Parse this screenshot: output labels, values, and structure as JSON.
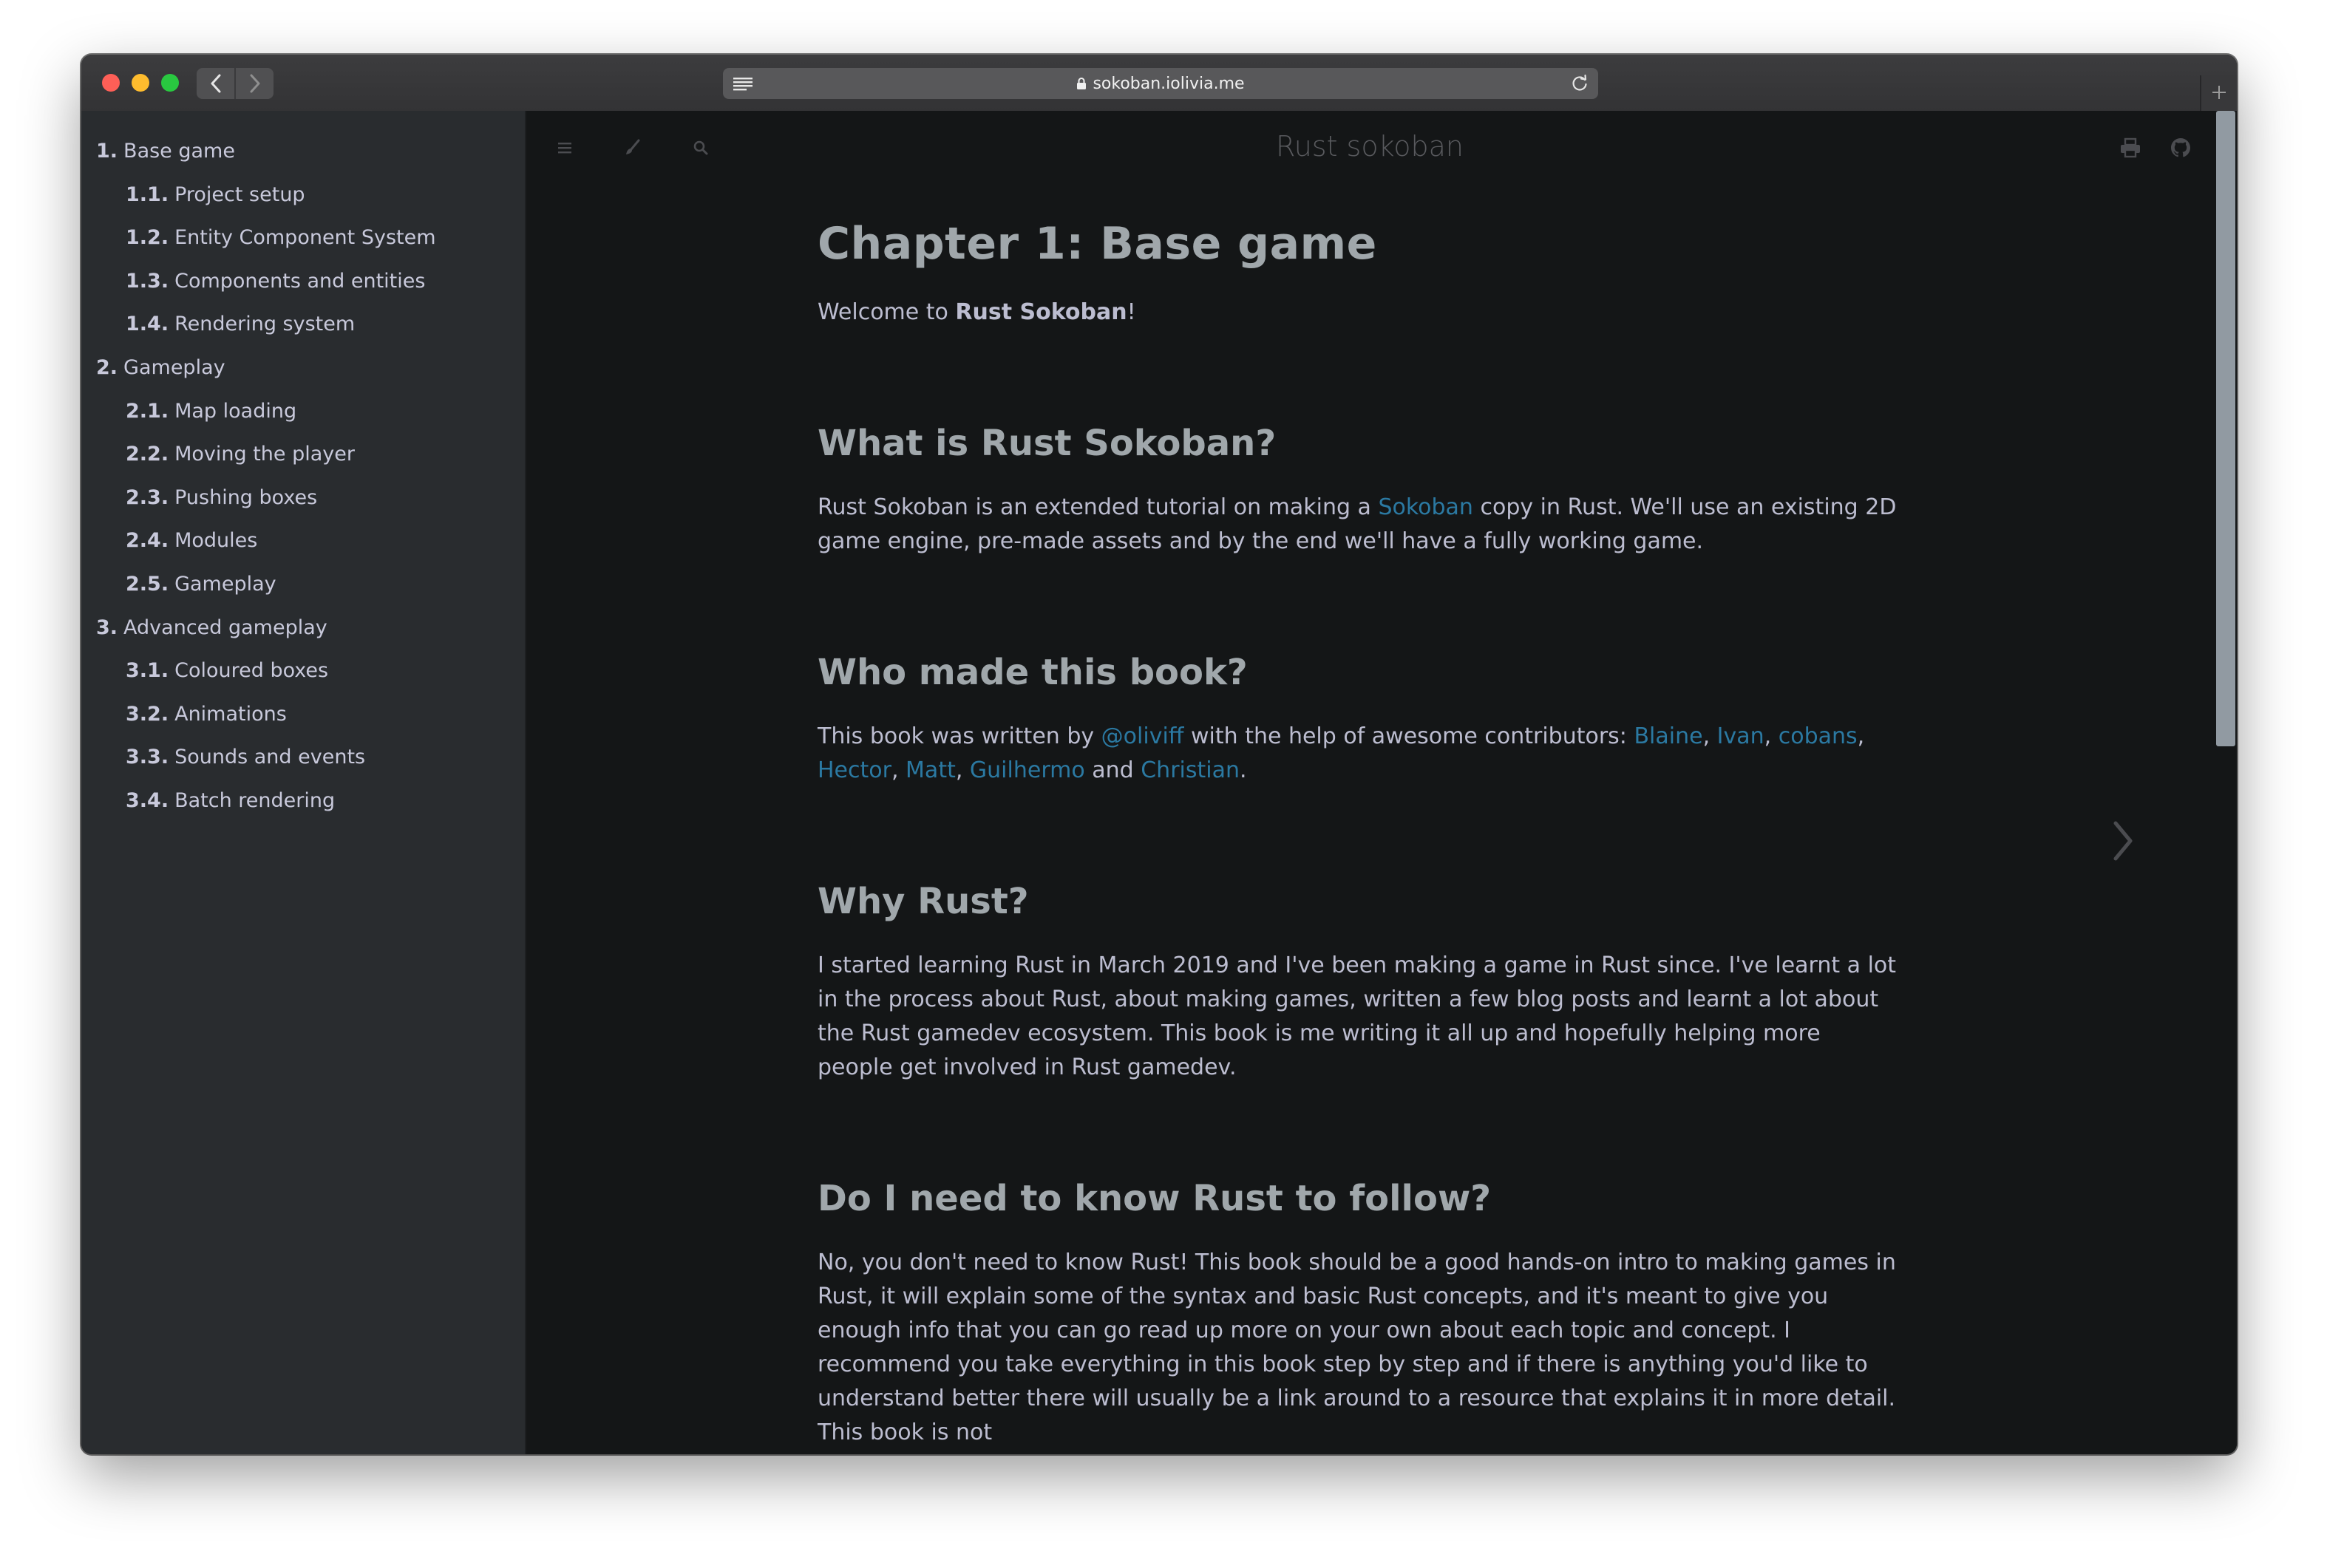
{
  "browser": {
    "url": "sokoban.iolivia.me"
  },
  "book": {
    "title": "Rust sokoban"
  },
  "sidebar": {
    "items": [
      {
        "num": "1.",
        "label": "Base game",
        "level": 1
      },
      {
        "num": "1.1.",
        "label": "Project setup",
        "level": 2
      },
      {
        "num": "1.2.",
        "label": "Entity Component System",
        "level": 2
      },
      {
        "num": "1.3.",
        "label": "Components and entities",
        "level": 2
      },
      {
        "num": "1.4.",
        "label": "Rendering system",
        "level": 2
      },
      {
        "num": "2.",
        "label": "Gameplay",
        "level": 1
      },
      {
        "num": "2.1.",
        "label": "Map loading",
        "level": 2
      },
      {
        "num": "2.2.",
        "label": "Moving the player",
        "level": 2
      },
      {
        "num": "2.3.",
        "label": "Pushing boxes",
        "level": 2
      },
      {
        "num": "2.4.",
        "label": "Modules",
        "level": 2
      },
      {
        "num": "2.5.",
        "label": "Gameplay",
        "level": 2
      },
      {
        "num": "3.",
        "label": "Advanced gameplay",
        "level": 1
      },
      {
        "num": "3.1.",
        "label": "Coloured boxes",
        "level": 2
      },
      {
        "num": "3.2.",
        "label": "Animations",
        "level": 2
      },
      {
        "num": "3.3.",
        "label": "Sounds and events",
        "level": 2
      },
      {
        "num": "3.4.",
        "label": "Batch rendering",
        "level": 2
      }
    ]
  },
  "article": {
    "h1": "Chapter 1: Base game",
    "welcome": {
      "before": "Welcome to ",
      "bold": "Rust Sokoban",
      "after": "!"
    },
    "s1": {
      "heading": "What is Rust Sokoban?",
      "before": "Rust Sokoban is an extended tutorial on making a ",
      "link": "Sokoban",
      "after": " copy in Rust. We'll use an existing 2D game engine, pre-made assets and by the end we'll have a fully working game."
    },
    "s2": {
      "heading": "Who made this book?",
      "before": "This book was written by ",
      "author": "@oliviff",
      "middle": " with the help of awesome contributors: ",
      "contributors": [
        "Blaine",
        "Ivan",
        "cobans",
        "Hector",
        "Matt",
        "Guilhermo",
        "Christian"
      ],
      "sep": ", ",
      "and": " and ",
      "end": "."
    },
    "s3": {
      "heading": "Why Rust?",
      "text": "I started learning Rust in March 2019 and I've been making a game in Rust since. I've learnt a lot in the process about Rust, about making games, written a few blog posts and learnt a lot about the Rust gamedev ecosystem. This book is me writing it all up and hopefully helping more people get involved in Rust gamedev."
    },
    "s4": {
      "heading": "Do I need to know Rust to follow?",
      "text": "No, you don't need to know Rust! This book should be a good hands-on intro to making games in Rust, it will explain some of the syntax and basic Rust concepts, and it's meant to give you enough info that you can go read up more on your own about each topic and concept. I recommend you take everything in this book step by step and if there is anything you'd like to understand better there will usually be a link around to a resource that explains it in more detail. This book is not"
    }
  },
  "icons": {
    "toolbar": [
      "hamburger-icon",
      "paintbrush-icon",
      "search-icon",
      "print-icon",
      "github-icon"
    ],
    "next": "chevron-right-icon"
  }
}
